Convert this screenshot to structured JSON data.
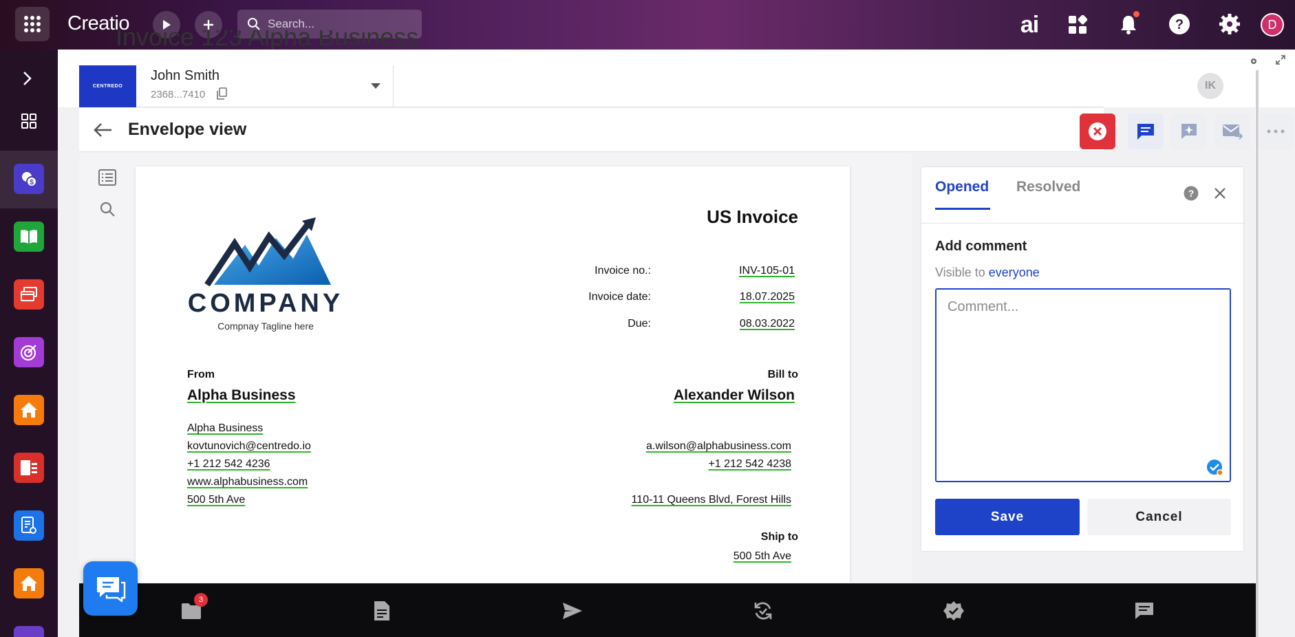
{
  "app": {
    "name": "Creatio",
    "search_placeholder": "Search..."
  },
  "topbar": {
    "user_initial": "D",
    "ai_label": "ai",
    "notification_dot_color": "#ff5a3c"
  },
  "record": {
    "bg_title": "Invoice 123 Alpha Business",
    "brand_text": "CENTREDO",
    "contact_name": "John Smith",
    "contact_id": "2368...7410",
    "assignee_initials": "IK"
  },
  "page": {
    "title": "Envelope view"
  },
  "invoice": {
    "title": "US Invoice",
    "company_name": "COMPANY",
    "company_tagline": "Compnay Tagline here",
    "meta": [
      {
        "label": "Invoice no.:",
        "value": "INV-105-01"
      },
      {
        "label": "Invoice date:",
        "value": "18.07.2025"
      },
      {
        "label": "Due:",
        "value": "08.03.2022"
      }
    ],
    "from": {
      "heading": "From",
      "name": "Alpha Business",
      "lines": [
        "Alpha Business",
        "kovtunovich@centredo.io",
        "+1 212 542 4236",
        "www.alphabusiness.com",
        "500 5th Ave"
      ]
    },
    "bill_to": {
      "heading": "Bill to",
      "name": "Alexander Wilson",
      "lines": [
        "a.wilson@alphabusiness.com",
        "+1 212 542 4238",
        "110-11 Queens Blvd, Forest Hills"
      ]
    },
    "ship_to": {
      "heading": "Ship to",
      "line": "500 5th Ave"
    }
  },
  "comments": {
    "tabs": [
      "Opened",
      "Resolved"
    ],
    "active_tab": "Opened",
    "add_title": "Add comment",
    "visible_prefix": "Visible to",
    "visible_link": "everyone",
    "placeholder": "Comment...",
    "save_label": "Save",
    "cancel_label": "Cancel"
  },
  "bottombar": {
    "folder_badge": "3"
  },
  "colors": {
    "accent": "#1f43c8",
    "danger": "#e0323a",
    "validated": "#2bb52b"
  }
}
